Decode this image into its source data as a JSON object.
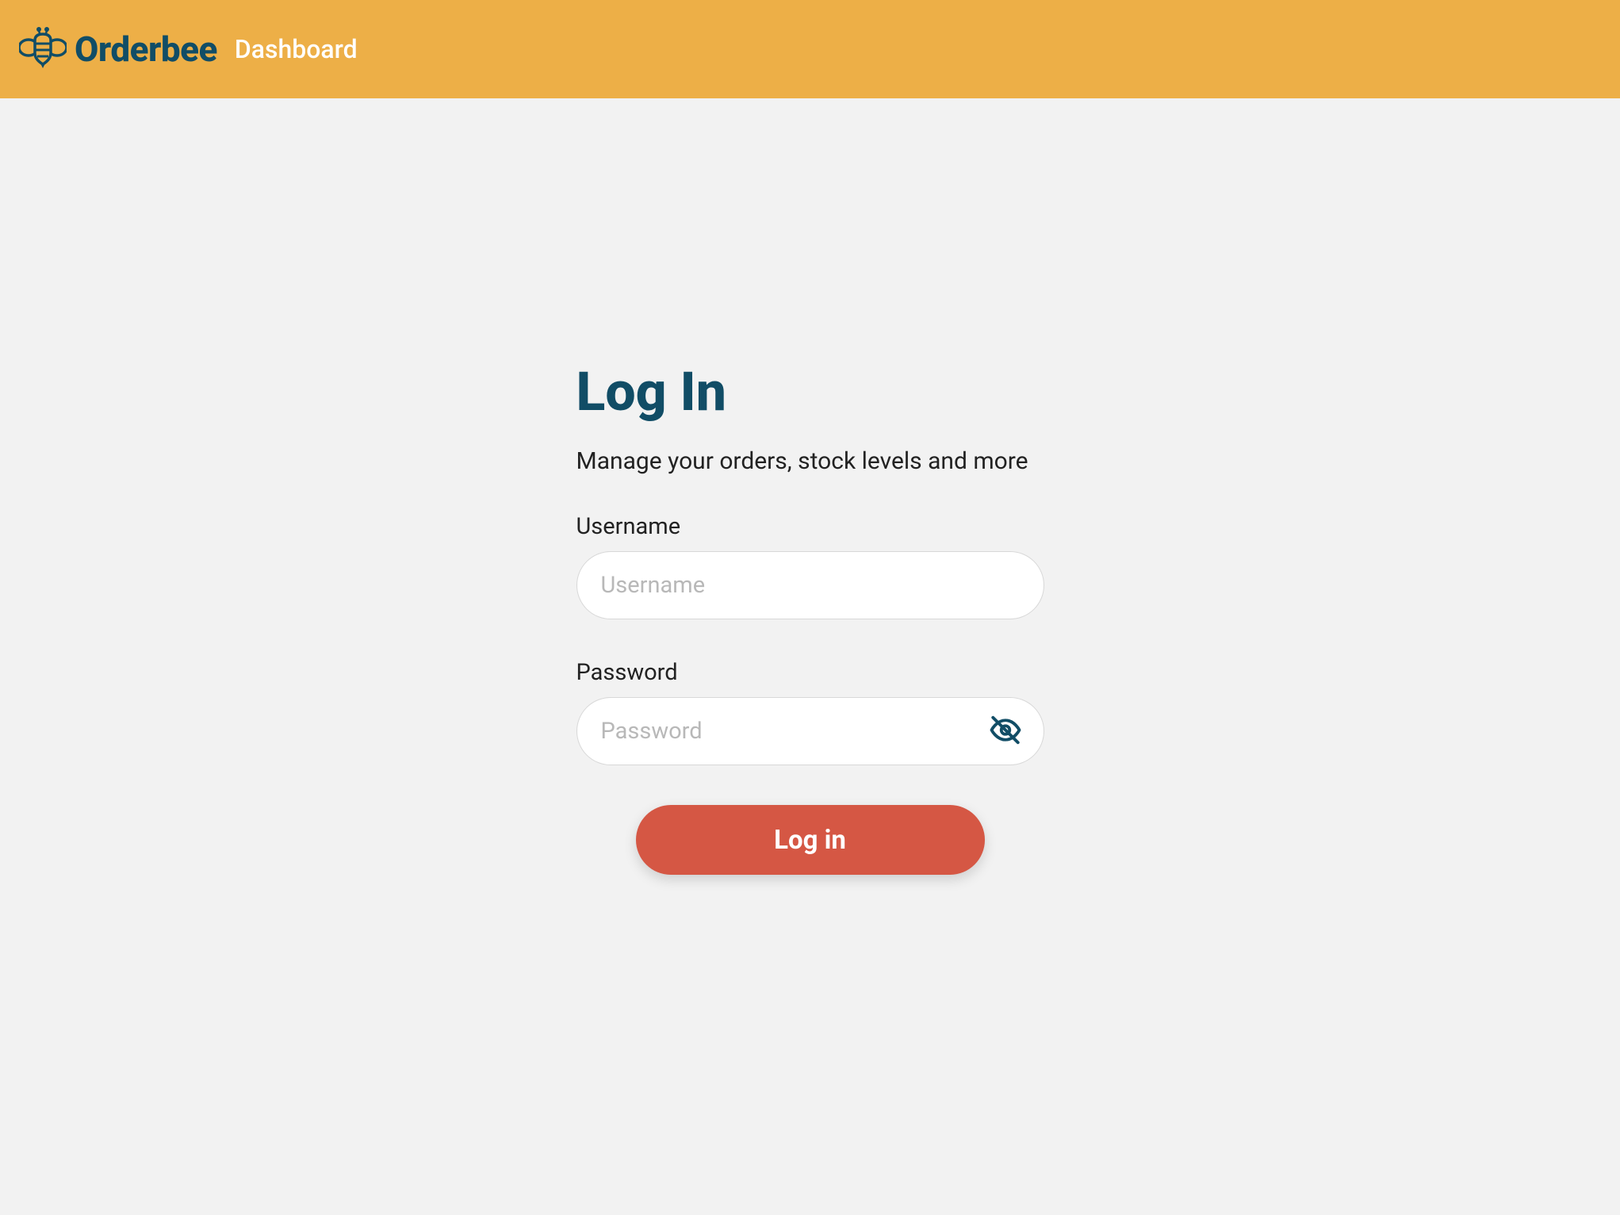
{
  "header": {
    "brand_name": "Orderbee",
    "subtitle": "Dashboard"
  },
  "login": {
    "title": "Log In",
    "subtitle": "Manage your orders, stock levels and more",
    "username_label": "Username",
    "username_placeholder": "Username",
    "username_value": "",
    "password_label": "Password",
    "password_placeholder": "Password",
    "password_value": "",
    "submit_label": "Log in"
  },
  "colors": {
    "header_bg": "#edaf47",
    "brand": "#114d66",
    "accent": "#d55744",
    "page_bg": "#f2f2f2"
  },
  "icons": {
    "logo": "bee-icon",
    "password_toggle": "eye-off-icon"
  }
}
